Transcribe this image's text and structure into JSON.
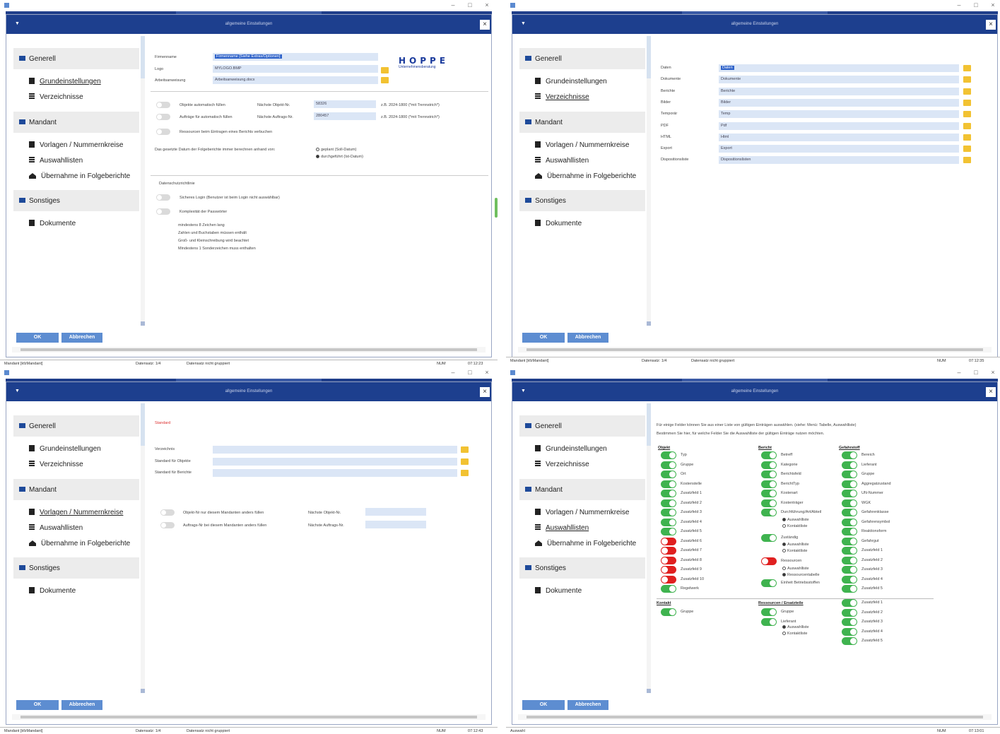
{
  "window": {
    "dialog_title": "allgemeine Einstellungen",
    "ok": "OK",
    "cancel": "Abbrechen"
  },
  "sidebar": {
    "generell": "Generell",
    "grund": "Grundeinstellungen",
    "verz": "Verzeichnisse",
    "mandant": "Mandant",
    "vorlagen": "Vorlagen / Nummernkreise",
    "ausw": "Auswahllisten",
    "uebernahme": "Übernahme in Folgeberichte",
    "sonstiges": "Sonstiges",
    "dokumente": "Dokumente"
  },
  "status": {
    "mandant": "Mandant [kfzMandant]",
    "mandant_b": "Mandant [kfzMandant]",
    "datensatz": "Datensatz: 1/4",
    "gruppe": "Datensatz nicht gruppiert",
    "num": "NUM",
    "time1": "07:12:23",
    "time2": "07:12:35",
    "time3": "07:12:43",
    "time4": "07:13:01",
    "q4left": "Auswahl"
  },
  "q1": {
    "firmenname_l": "Firmenname",
    "firmenname_v": "Firmenname [Siehe Extras/Optionen]",
    "logo_l": "Logo",
    "logo_v": "MYLOGO.BMP",
    "arbeit_l": "Arbeitsanweisung",
    "arbeit_v": "Arbeitsanweisung.docx",
    "logo_big": "HOPPE",
    "logo_small": "Unternehmensberatung",
    "t1": "Objekte automatisch füllen",
    "t2": "Aufträge für automatisch füllen",
    "t3": "Ressourcen beim Eintragen eines Berichts verbuchen",
    "no_l": "Nächste Objekt-Nr.",
    "no_v": "58326",
    "na_l": "Nächste Auftrags-Nr.",
    "na_v": "280457",
    "ex1": "z.B. 2024-1800 (*mit Trennstrich*)",
    "ex2": "z.B. 2024-1800 (*mit Trennstrich*)",
    "datum_q": "Das gesetzte Datum der Folgeberichte immer berechnen anhand von:",
    "r1": "geplant (Soll-Datum)",
    "r2": "durchgeführt (Ist-Datum)",
    "ds": "Datenschutzrichtlinie",
    "t4": "Sicheres Login (Benutzer ist beim Login nicht auswählbar)",
    "t5": "Komplexität der Passwörter",
    "p1": "mindestens 8 Zeichen lang",
    "p2": "Zahlen und Buchstaben müssen enthält",
    "p3": "Groß- und Kleinschreibung wird beachtet",
    "p4": "Mindestens 1 Sonderzeichen muss enthalten"
  },
  "q2": {
    "rows": [
      {
        "l": "Daten",
        "v": "Daten"
      },
      {
        "l": "Dokumente",
        "v": "Dokumente"
      },
      {
        "l": "Berichte",
        "v": "Berichte"
      },
      {
        "l": "Bilder",
        "v": "Bilder"
      },
      {
        "l": "Temporär",
        "v": "Temp"
      },
      {
        "l": "PDF",
        "v": "Pdf"
      },
      {
        "l": "HTML",
        "v": "Html"
      },
      {
        "l": "Export",
        "v": "Export"
      },
      {
        "l": "Dispositionsliste",
        "v": "Dispositionslisten"
      }
    ]
  },
  "q3": {
    "standard": "Standard",
    "rows": [
      {
        "l": "Verzeichnis",
        "v": ""
      },
      {
        "l": "Standard für Objekte",
        "v": ""
      },
      {
        "l": "Standard für Berichte",
        "v": ""
      }
    ],
    "t1": "Objekt-Nr nur diesem Mandanten anders füllen",
    "t2": "Auftrags-Nr bei diesem Mandanten anders füllen",
    "no_l": "Nächste Objekt-Nr.",
    "na_l": "Nächste Auftrags-Nr."
  },
  "q4": {
    "intro1": "Für einige Felder können Sie aus einer Liste von gültigen Einträgen auswählen. (siehe: Menü: Tabelle, Auswahlliste)",
    "intro2": "Bestimmen Sie hier, für welche Felder Sie die Auswahlliste der gültigen Einträge nutzen möchten.",
    "objekt": "Objekt",
    "bericht": "Bericht",
    "gefahrstoff": "Gefahrstoff",
    "kontakt": "Kontakt",
    "ressourcen": "Ressourcen / Ersatzteile",
    "objekt_items": [
      "Typ",
      "Gruppe",
      "Ort",
      "Kostenstelle",
      "Zusatzfeld 1",
      "Zusatzfeld 2",
      "Zusatzfeld 3",
      "Zusatzfeld 4",
      "Zusatzfeld 5",
      "Zusatzfeld 6",
      "Zusatzfeld 7",
      "Zusatzfeld 8",
      "Zusatzfeld 9",
      "Zusatzfeld 10",
      "Regelwerk"
    ],
    "bericht_items": [
      "Betreff",
      "Kategorie",
      "Berichtsfeld",
      "BerichtTyp",
      "Kostenart",
      "Kostenträger",
      "Durchführung/Art/Abteil",
      "Zuständig",
      "Ressourcen",
      "Einheit Betriebsstoffen"
    ],
    "gef_items": [
      "Bereich",
      "Lieferant",
      "Gruppe",
      "Aggregatzustand",
      "UN-Nummer",
      "WGK",
      "Gefahrenklasse",
      "Gefahrensymbol",
      "Reaktionsform",
      "Gefahrgut",
      "Zusatzfeld 1",
      "Zusatzfeld 2",
      "Zusatzfeld 3",
      "Zusatzfeld 4",
      "Zusatzfeld 5"
    ],
    "kontakt_items": [
      "Gruppe"
    ],
    "ress_items": [
      "Gruppe",
      "Lieferant"
    ],
    "gef2_items": [
      "Zusatzfeld 1",
      "Zusatzfeld 2",
      "Zusatzfeld 3",
      "Zusatzfeld 4",
      "Zusatzfeld 5"
    ],
    "opt_a": "Auswahlliste",
    "opt_k": "Kontaktliste",
    "opt_r": "Ressourcentabelle"
  }
}
